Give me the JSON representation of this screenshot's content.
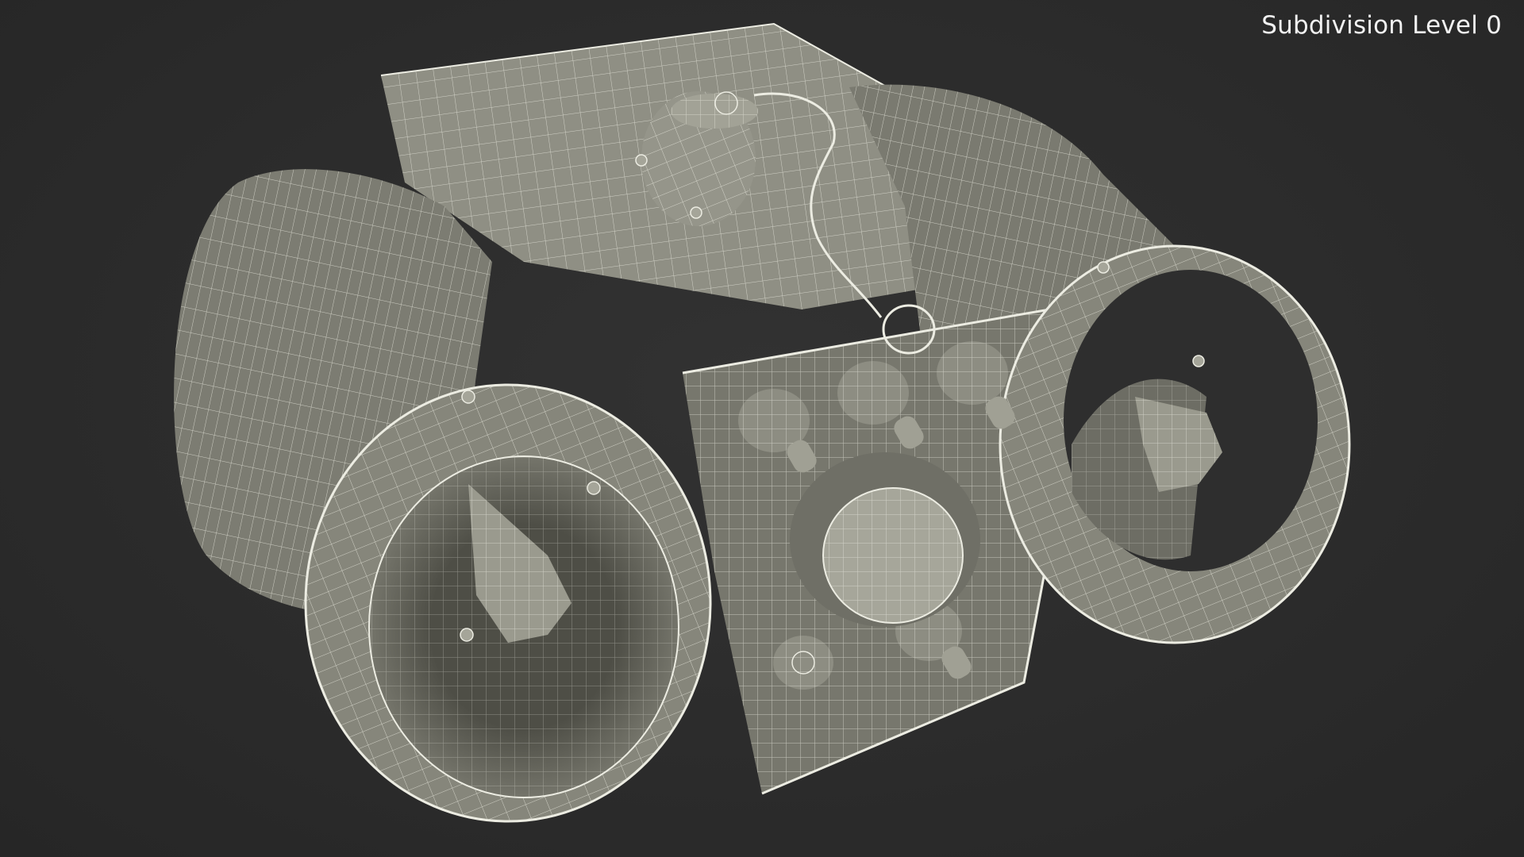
{
  "viewport": {
    "label": "Subdivision Level 0",
    "background_color": "#2b2b2b",
    "model_color": "#8a8a7e",
    "wire_color": "#e6e6dc",
    "shade_color": "#5f5f56"
  }
}
